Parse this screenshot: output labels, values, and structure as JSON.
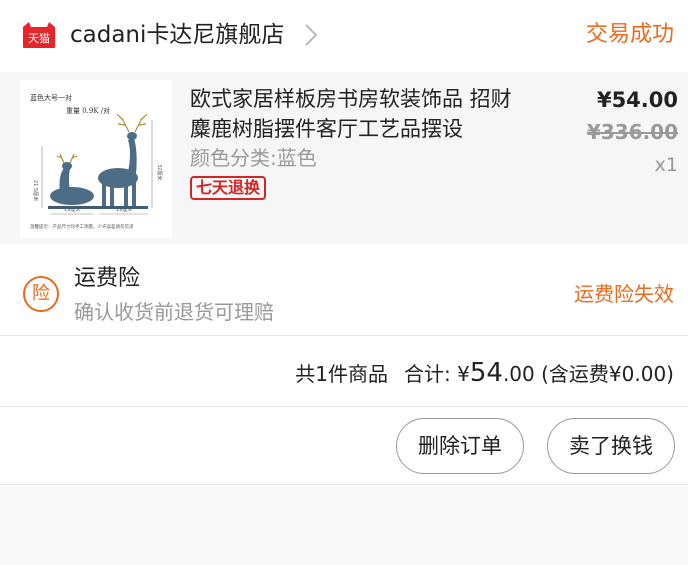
{
  "header": {
    "logo_text": "天猫",
    "shop_name": "cadani卡达尼旗舰店",
    "status": "交易成功",
    "accent_color": "#ec6a1c",
    "logo_color": "#e8252b"
  },
  "item": {
    "title": "欧式家居样板房书房软装饰品 招财麋鹿树脂摆件客厅工艺品摆设",
    "variant": "颜色分类:蓝色",
    "badge": "七天退换",
    "price": "¥54.00",
    "original_price": "¥336.00",
    "quantity": "x1",
    "thumbnail": {
      "label_top": "蓝色大号一对",
      "label_weight": "重量 0.9K /对",
      "dim_left": "19厘米",
      "dim_right": "19厘米",
      "dim_height_left": "21.5厘米",
      "dim_height_right": "32厘米",
      "footnote": "温馨提示：产品尺寸均手工测量，少许误差请勿见谅"
    }
  },
  "insurance": {
    "icon_char": "险",
    "title": "运费险",
    "description": "确认收货前退货可理赔",
    "status": "运费险失效"
  },
  "summary": {
    "count_text": "共1件商品",
    "total_label": "合计: ¥",
    "total_int": "54",
    "total_dec": ".00",
    "shipping_text": "(含运费¥0.00)"
  },
  "actions": {
    "delete_label": "删除订单",
    "sell_label": "卖了换钱"
  }
}
